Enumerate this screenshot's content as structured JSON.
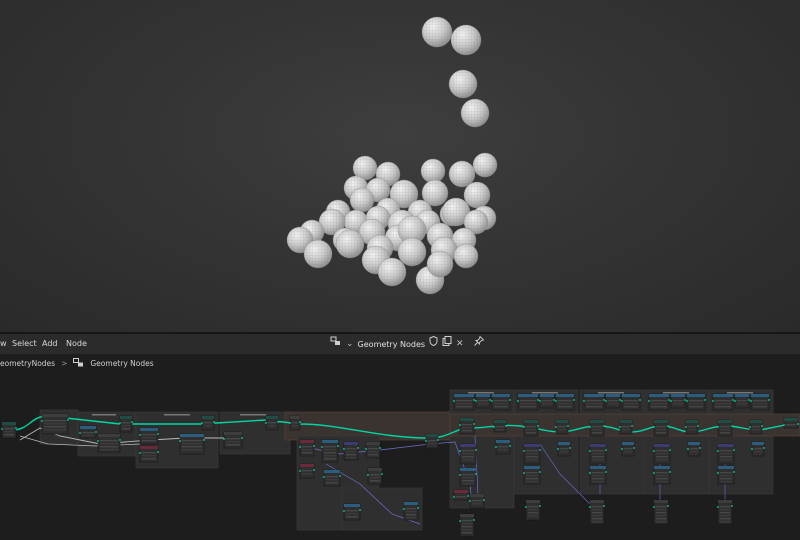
{
  "editor_header": {
    "menu": [
      "w",
      "Select",
      "Add",
      "Node"
    ],
    "tree_name": "Geometry Nodes",
    "icons": [
      "node-tree-icon",
      "chevron-down-icon",
      "shield-fake-user-icon",
      "duplicate-icon",
      "close-icon",
      "pin-icon"
    ]
  },
  "breadcrumb": {
    "object": "eometryNodes",
    "separator": ">",
    "tree": "Geometry Nodes"
  },
  "colors": {
    "viewport_bg": "#383838",
    "editor_bg": "#1d1d1d",
    "header_bg": "#2b2b2b",
    "frame_bg": "#313131",
    "node_body": "#303030",
    "node_header_geometry": "#1f4d45",
    "link_geometry": "#00d6a3",
    "link_float": "#a1a1a1",
    "socket_vector": "#6363c7",
    "socket_int": "#e35a8f",
    "accent_header": "#2b6b98"
  }
}
